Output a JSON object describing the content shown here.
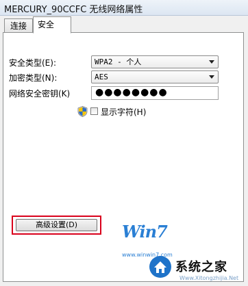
{
  "window": {
    "title": "MERCURY_90CCFC 无线网络属性"
  },
  "tabs": [
    {
      "label": "连接",
      "active": false
    },
    {
      "label": "安全",
      "active": true
    }
  ],
  "security": {
    "security_type_label": "安全类型(E):",
    "security_type_value": "WPA2 - 个人",
    "encryption_type_label": "加密类型(N):",
    "encryption_type_value": "AES",
    "network_key_label": "网络安全密钥(K)",
    "network_key_value": "●●●●●●●●",
    "show_characters_label": "显示字符(H)",
    "show_characters_checked": false
  },
  "buttons": {
    "advanced_label": "高级设置(D)"
  },
  "watermark": {
    "logo_text": "Win7",
    "brand_name": "系统之家",
    "url_small": "www.winwin7.com",
    "url_brand": "Www.Xitongzhijia.Net"
  },
  "colors": {
    "highlight_border": "#d9001b",
    "watermark_blue": "#2a7fd4"
  }
}
